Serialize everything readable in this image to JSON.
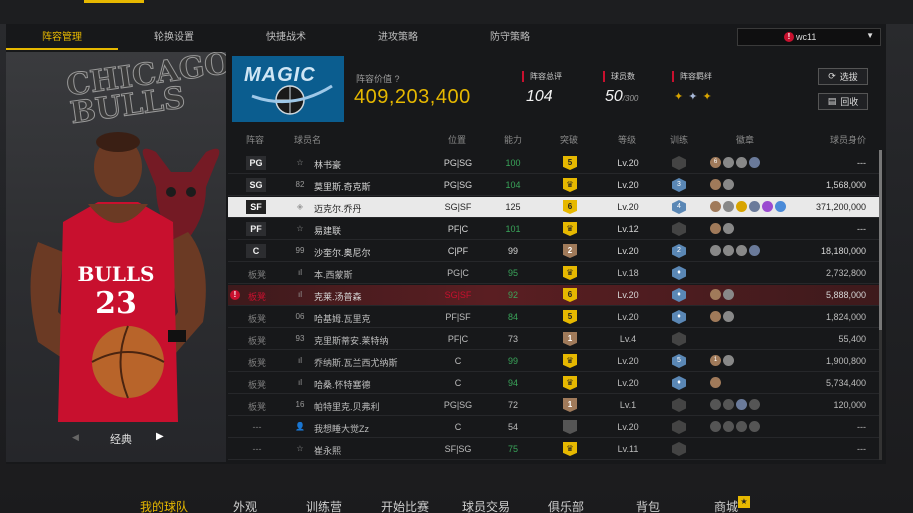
{
  "subtabs": [
    "阵容管理",
    "轮换设置",
    "快捷战术",
    "进攻策略",
    "防守策略"
  ],
  "user": {
    "name": "wc11",
    "alert": "!"
  },
  "player_card": {
    "team_text": "CHICAGO BULLS",
    "jersey_text": "BULLS",
    "number": "23",
    "nav_label": "经典",
    "prev": "◀",
    "next": "▶"
  },
  "team": {
    "logo_text": "MAGIC"
  },
  "header": {
    "value_label": "阵容价值",
    "value": "409,203,400",
    "rating_label": "阵容总评",
    "rating": "104",
    "count_label": "球员数",
    "count": "50",
    "count_max": "/300",
    "bonds_label": "阵容羁绊",
    "select_btn": "选拔",
    "recycle_btn": "回收"
  },
  "columns": [
    "阵容",
    "球员名",
    "位置",
    "能力",
    "突破",
    "等级",
    "训练",
    "徽章",
    "球员身价"
  ],
  "rows": [
    {
      "slot": "PG",
      "num": "☆",
      "name": "林书豪",
      "pos": "PG|SG",
      "ovr": "100",
      "ovr_green": true,
      "bt": "5",
      "bt_style": "gold",
      "level": "Lv.20",
      "train": "",
      "train_dim": true,
      "badges": [
        "#a07a5a",
        "#888",
        "#888",
        "#6a7a9a"
      ],
      "badge_num": "6",
      "salary": "---",
      "type": "starter"
    },
    {
      "slot": "SG",
      "num": "82",
      "name": "莫里斯.奇克斯",
      "pos": "PG|SG",
      "ovr": "104",
      "ovr_green": true,
      "bt": "♛",
      "bt_style": "gold",
      "level": "Lv.20",
      "train": "3",
      "train_dim": false,
      "badges": [
        "#a07a5a",
        "#888"
      ],
      "salary": "1,568,000",
      "type": "starter"
    },
    {
      "slot": "SF",
      "num": "◈",
      "name": "迈克尔.乔丹",
      "pos": "SG|SF",
      "ovr": "125",
      "ovr_green": false,
      "bt": "6",
      "bt_style": "gold",
      "level": "Lv.20",
      "train": "4",
      "train_dim": false,
      "badges": [
        "#a07a5a",
        "#888",
        "#d8a400",
        "#6a7a9a",
        "#9a4ad0",
        "#4a8ad8"
      ],
      "salary": "371,200,000",
      "type": "selected"
    },
    {
      "slot": "PF",
      "num": "☆",
      "name": "易建联",
      "pos": "PF|C",
      "ovr": "101",
      "ovr_green": true,
      "bt": "♛",
      "bt_style": "gold",
      "level": "Lv.12",
      "train": "",
      "train_dim": true,
      "badges": [
        "#a07a5a",
        "#888"
      ],
      "salary": "---",
      "type": "starter"
    },
    {
      "slot": "C",
      "num": "99",
      "name": "沙奎尔.奥尼尔",
      "pos": "C|PF",
      "ovr": "99",
      "ovr_green": false,
      "bt": "2",
      "bt_style": "bronze",
      "level": "Lv.20",
      "train": "2",
      "train_dim": false,
      "badges": [
        "#888",
        "#888",
        "#888",
        "#6a7a9a"
      ],
      "salary": "18,180,000",
      "type": "starter"
    },
    {
      "slot": "板凳",
      "num": "ıl",
      "name": "本.西蒙斯",
      "pos": "PG|C",
      "ovr": "95",
      "ovr_green": true,
      "bt": "♛",
      "bt_style": "gold",
      "level": "Lv.18",
      "train": "♦",
      "train_dim": false,
      "badges": [],
      "salary": "2,732,800",
      "type": "bench"
    },
    {
      "slot": "板凳",
      "num": "ıl",
      "name": "克莱.汤普森",
      "pos": "SG|SF",
      "ovr": "92",
      "ovr_green": true,
      "bt": "6",
      "bt_style": "gold",
      "level": "Lv.20",
      "train": "♦",
      "train_dim": false,
      "badges": [
        "#a07a5a",
        "#888"
      ],
      "salary": "5,888,000",
      "type": "warn",
      "alert": "!"
    },
    {
      "slot": "板凳",
      "num": "06",
      "name": "哈基姆.瓦里克",
      "pos": "PF|SF",
      "ovr": "84",
      "ovr_green": true,
      "bt": "5",
      "bt_style": "gold",
      "level": "Lv.20",
      "train": "♦",
      "train_dim": false,
      "badges": [
        "#a07a5a",
        "#888"
      ],
      "salary": "1,824,000",
      "type": "bench"
    },
    {
      "slot": "板凳",
      "num": "93",
      "name": "克里斯蒂安.莱特纳",
      "pos": "PF|C",
      "ovr": "73",
      "ovr_green": false,
      "bt": "1",
      "bt_style": "bronze",
      "level": "Lv.4",
      "train": "",
      "train_dim": true,
      "badges": [],
      "salary": "55,400",
      "type": "bench"
    },
    {
      "slot": "板凳",
      "num": "ıl",
      "name": "乔纳斯.瓦兰西尤纳斯",
      "pos": "C",
      "ovr": "99",
      "ovr_green": true,
      "bt": "♛",
      "bt_style": "gold",
      "level": "Lv.20",
      "train": "5",
      "train_dim": false,
      "badges": [
        "#a07a5a",
        "#888"
      ],
      "badge_num": "1",
      "salary": "1,900,800",
      "type": "bench"
    },
    {
      "slot": "板凳",
      "num": "ıl",
      "name": "哈桑.怀特塞德",
      "pos": "C",
      "ovr": "94",
      "ovr_green": true,
      "bt": "♛",
      "bt_style": "gold",
      "level": "Lv.20",
      "train": "♦",
      "train_dim": false,
      "badges": [
        "#a07a5a"
      ],
      "salary": "5,734,400",
      "type": "bench"
    },
    {
      "slot": "板凳",
      "num": "16",
      "name": "帕特里克.贝弗利",
      "pos": "PG|SG",
      "ovr": "72",
      "ovr_green": false,
      "bt": "1",
      "bt_style": "bronze",
      "level": "Lv.1",
      "train": "",
      "train_dim": true,
      "badges": [
        "#555",
        "#555",
        "#6a7a9a",
        "#555"
      ],
      "salary": "120,000",
      "type": "bench"
    },
    {
      "slot": "---",
      "num": "👤",
      "name": "我想睡大觉Zz",
      "pos": "C",
      "ovr": "54",
      "ovr_green": false,
      "bt": "",
      "bt_style": "gray",
      "level": "Lv.20",
      "train": "",
      "train_dim": true,
      "badges": [
        "#555",
        "#555",
        "#555",
        "#555"
      ],
      "salary": "---",
      "type": "bench"
    },
    {
      "slot": "---",
      "num": "☆",
      "name": "崔永熙",
      "pos": "SF|SG",
      "ovr": "75",
      "ovr_green": true,
      "bt": "♛",
      "bt_style": "gold",
      "level": "Lv.11",
      "train": "",
      "train_dim": true,
      "badges": [],
      "salary": "---",
      "type": "bench"
    }
  ],
  "bottom_nav": [
    "我的球队",
    "外观",
    "训练营",
    "开始比赛",
    "球员交易",
    "俱乐部",
    "背包",
    "商城"
  ]
}
